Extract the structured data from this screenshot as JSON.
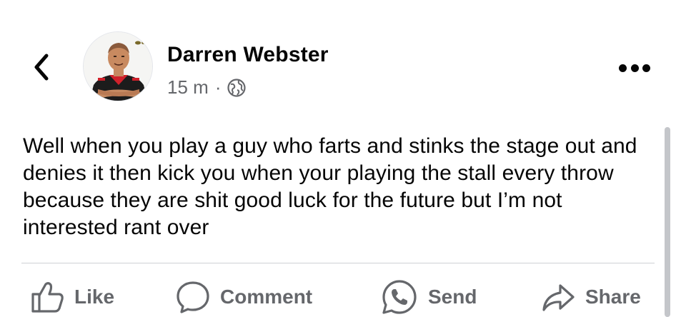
{
  "header": {
    "author_name": "Darren Webster",
    "time_ago": "15 m",
    "separator": "·",
    "audience_icon": "globe-icon",
    "back_icon": "chevron-left-icon",
    "more_icon": "more-horizontal-icon"
  },
  "post": {
    "text": "Well when you play a guy who farts and stinks the stage out and denies it then kick you when your playing the stall every throw because they are shit good luck for the future but I’m not interested rant over"
  },
  "actions": [
    {
      "label": "Like",
      "icon": "thumbs-up-icon"
    },
    {
      "label": "Comment",
      "icon": "comment-bubble-icon"
    },
    {
      "label": "Send",
      "icon": "whatsapp-icon"
    },
    {
      "label": "Share",
      "icon": "share-arrow-icon"
    }
  ],
  "colors": {
    "text": "#050505",
    "secondary": "#65676b",
    "divider": "#ced0d4",
    "avatar_shirt": "#1c1c1c",
    "avatar_accent": "#d0212b"
  }
}
